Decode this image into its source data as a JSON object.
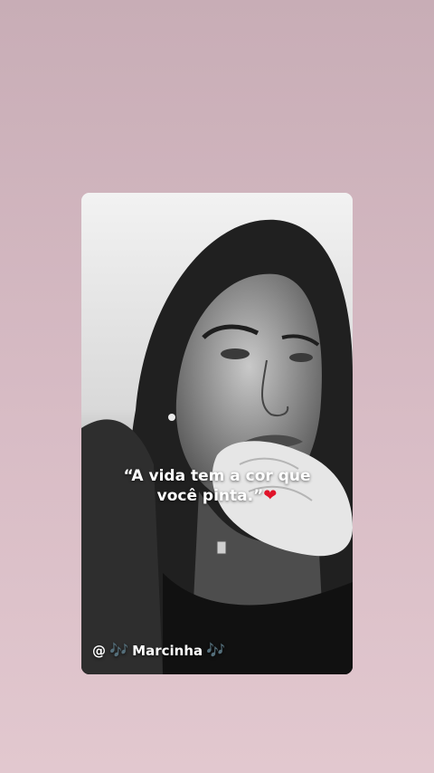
{
  "story": {
    "quote_line1": "“A vida tem a cor que",
    "quote_line2": "você pinta.”",
    "quote_emoji": "❤",
    "mention": {
      "prefix": "@",
      "notes_left": "🎶",
      "name": "Marcinha",
      "notes_right": "🎶"
    },
    "photo_description_icon": "portrait-photo-icon"
  },
  "colors": {
    "background_top": "#c8adb6",
    "background_bottom": "#e2c8cf",
    "text": "#ffffff",
    "heart": "#e0142a",
    "notes": "#49b7e8"
  }
}
